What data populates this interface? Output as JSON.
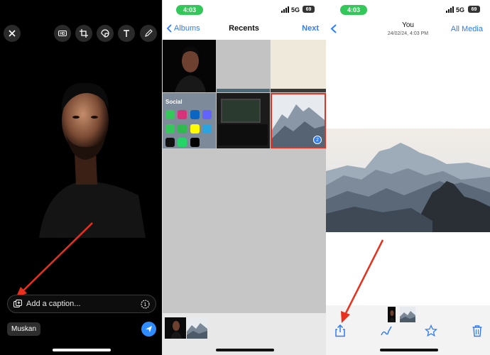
{
  "panel1": {
    "toolbar_icons": [
      "close-icon",
      "hd-icon",
      "crop-icon",
      "sticker-icon",
      "text-icon",
      "pencil-icon"
    ],
    "caption_placeholder": "Add a caption...",
    "recipient": "Muskan",
    "accent": "#2f8cff",
    "arrow_color": "#e8301e"
  },
  "panel2": {
    "status": {
      "time": "4:03",
      "network": "5G",
      "battery": "69"
    },
    "nav": {
      "back_label": "Albums",
      "title": "Recents",
      "next_label": "Next"
    },
    "social_folder": {
      "label": "Social"
    },
    "selected_badge": "2",
    "highlight_color": "#e8301e"
  },
  "panel3": {
    "status": {
      "time": "4:03",
      "network": "5G",
      "battery": "69"
    },
    "header": {
      "title": "You",
      "subtitle": "24/02/24, 4:03 PM",
      "all_media_label": "All Media"
    },
    "toolbar_icons": [
      "share-icon",
      "draw-icon",
      "star-icon",
      "trash-icon"
    ],
    "accent": "#2f7cf6"
  }
}
